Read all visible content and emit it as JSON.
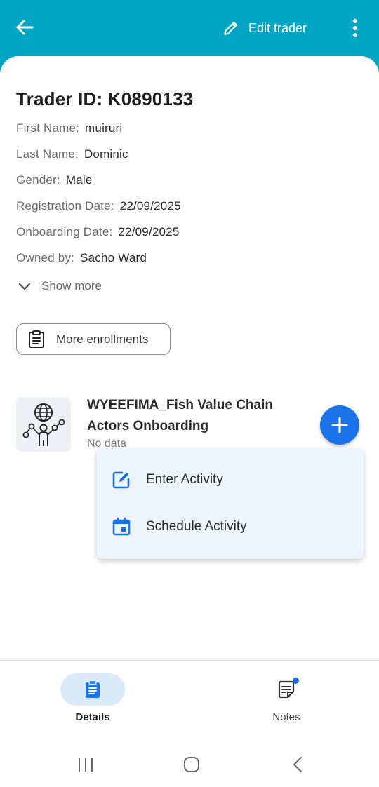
{
  "header": {
    "edit_label": "Edit trader",
    "background": "#00a6c4",
    "icons": {
      "back": "arrow-left-icon",
      "edit": "pencil-icon",
      "more": "more-vert-icon"
    }
  },
  "trader": {
    "title": "Trader ID: K0890133",
    "fields": [
      {
        "label": "First Name:",
        "value": "muiruri"
      },
      {
        "label": "Last Name:",
        "value": "Dominic"
      },
      {
        "label": "Gender:",
        "value": "Male"
      },
      {
        "label": "Registration Date:",
        "value": "22/09/2025"
      },
      {
        "label": "Onboarding Date:",
        "value": "22/09/2025"
      },
      {
        "label": "Owned by:",
        "value": "Sacho Ward"
      }
    ],
    "show_more": "Show more"
  },
  "enrollments_button": "More enrollments",
  "program": {
    "title": "WYEEFIMA_Fish Value Chain Actors Onboarding",
    "subtitle": "No data",
    "icon": "global-network-person-icon"
  },
  "fab": {
    "icon": "plus-icon",
    "color": "#1a73e8"
  },
  "menu": {
    "items": [
      {
        "label": "Enter Activity",
        "icon": "edit-note-icon"
      },
      {
        "label": "Schedule Activity",
        "icon": "calendar-icon"
      }
    ],
    "accent": "#1a73e8"
  },
  "bottom_nav": {
    "items": [
      {
        "label": "Details",
        "icon": "clipboard-icon",
        "selected": true
      },
      {
        "label": "Notes",
        "icon": "note-icon",
        "selected": false,
        "badge": true
      }
    ]
  },
  "system_nav": [
    "recents-icon",
    "home-icon",
    "back-icon"
  ]
}
